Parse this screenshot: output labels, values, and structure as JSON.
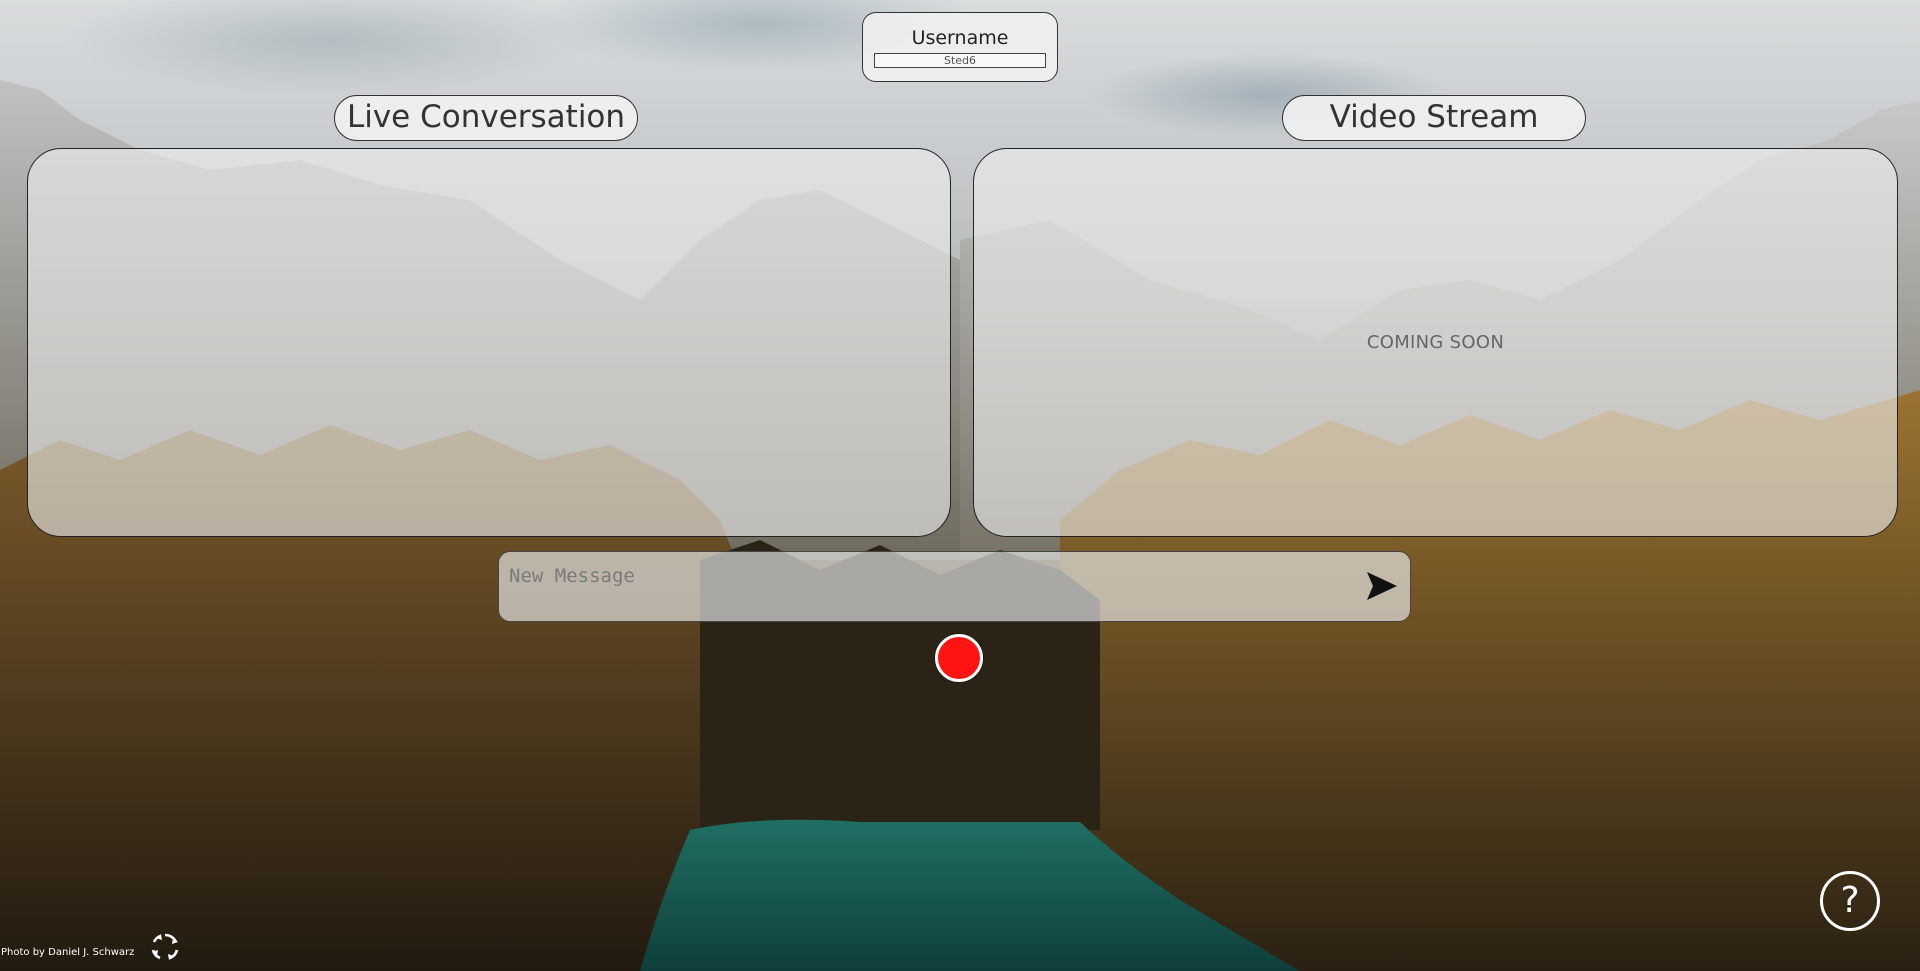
{
  "username": {
    "title": "Username",
    "value": "Sted6"
  },
  "live_conversation": {
    "title": "Live Conversation"
  },
  "video_stream": {
    "title": "Video Stream",
    "status": "COMING SOON"
  },
  "message_bar": {
    "placeholder": "New Message",
    "value": "",
    "send_icon": "send-icon"
  },
  "record": {
    "icon": "record-icon",
    "color": "#ff1414"
  },
  "help": {
    "label": "?"
  },
  "footer": {
    "photo_credit": "Photo by Daniel J. Schwarz",
    "refresh_icon": "refresh-icon"
  },
  "colors": {
    "panel_bg": "#eeeeee",
    "border": "#222222",
    "record": "#ff1414"
  }
}
